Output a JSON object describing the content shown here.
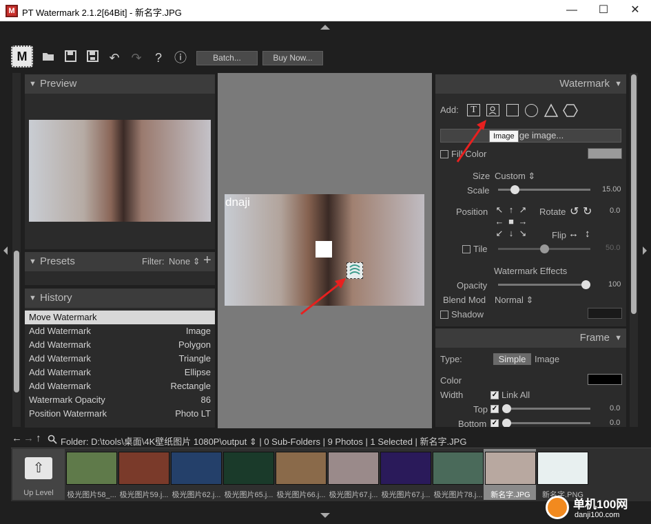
{
  "titlebar": {
    "title": "PT Watermark 2.1.2[64Bit] - 新名字.JPG",
    "app_icon": "M",
    "minimize": "—",
    "maximize": "☐",
    "close": "✕"
  },
  "toolbar": {
    "logo": "M",
    "batch_label": "Batch...",
    "buy_label": "Buy Now..."
  },
  "preview": {
    "title": "Preview"
  },
  "presets": {
    "title": "Presets",
    "filter_label": "Filter:",
    "filter_value": "None"
  },
  "history": {
    "title": "History",
    "items": [
      {
        "action": "Move Watermark",
        "detail": ""
      },
      {
        "action": "Add Watermark",
        "detail": "Image"
      },
      {
        "action": "Add Watermark",
        "detail": "Polygon"
      },
      {
        "action": "Add Watermark",
        "detail": "Triangle"
      },
      {
        "action": "Add Watermark",
        "detail": "Ellipse"
      },
      {
        "action": "Add Watermark",
        "detail": "Rectangle"
      },
      {
        "action": "Watermark Opacity",
        "detail": "86"
      },
      {
        "action": "Position Watermark",
        "detail": "Photo LT"
      }
    ]
  },
  "canvas": {
    "text_watermark": "dnaji"
  },
  "watermark": {
    "title": "Watermark",
    "add_label": "Add:",
    "tooltip": "Image",
    "change_image_label": "Change image...",
    "fill_color_label": "Fill Color",
    "fill_color": "#9a9a9a",
    "size_label": "Size",
    "size_value": "Custom",
    "scale_label": "Scale",
    "scale_value": "15.00",
    "scale_fraction": 0.15,
    "position_label": "Position",
    "rotate_label": "Rotate",
    "rotate_value": "0.0",
    "flip_label": "Flip",
    "tile_label": "Tile",
    "tile_value": "50.0",
    "tile_fraction": 0.5,
    "effects_label": "Watermark Effects",
    "opacity_label": "Opacity",
    "opacity_value": "100",
    "opacity_fraction": 1.0,
    "blend_label": "Blend Mod",
    "blend_value": "Normal",
    "shadow_label": "Shadow",
    "shadow_color": "#1a1a1a"
  },
  "frame": {
    "title": "Frame",
    "type_label": "Type:",
    "type_simple": "Simple",
    "type_image": "Image",
    "color_label": "Color",
    "color": "#000000",
    "width_label": "Width",
    "link_all_label": "Link All",
    "top_label": "Top",
    "top_value": "0.0",
    "bottom_label": "Bottom",
    "bottom_value": "0.0"
  },
  "folderbar": {
    "text": "Folder:  D:\\tools\\桌面\\4K壁纸图片 1080P\\output ⇕ | 0 Sub-Folders | 9 Photos | 1 Selected | 新名字.JPG"
  },
  "filmstrip": {
    "up_level": "Up Level",
    "items": [
      {
        "label": "极光图片58_...",
        "color": "#5f7a4a"
      },
      {
        "label": "极光图片59.j...",
        "color": "#7a3a2a"
      },
      {
        "label": "极光图片62.j...",
        "color": "#24406a"
      },
      {
        "label": "极光图片65.j...",
        "color": "#1a3a2a"
      },
      {
        "label": "极光图片66.j...",
        "color": "#8a6a4a"
      },
      {
        "label": "极光图片67.j...",
        "color": "#9a8a8a"
      },
      {
        "label": "极光图片67.j...",
        "color": "#2a1a5a"
      },
      {
        "label": "极光图片78.j...",
        "color": "#4a6a5a"
      },
      {
        "label": "新名字.JPG",
        "color": "#b8a8a0"
      },
      {
        "label": "新名字.PNG",
        "color": "#e8f0f0"
      }
    ]
  },
  "watermark_site": {
    "name": "单机100网",
    "url": "danji100.com"
  }
}
